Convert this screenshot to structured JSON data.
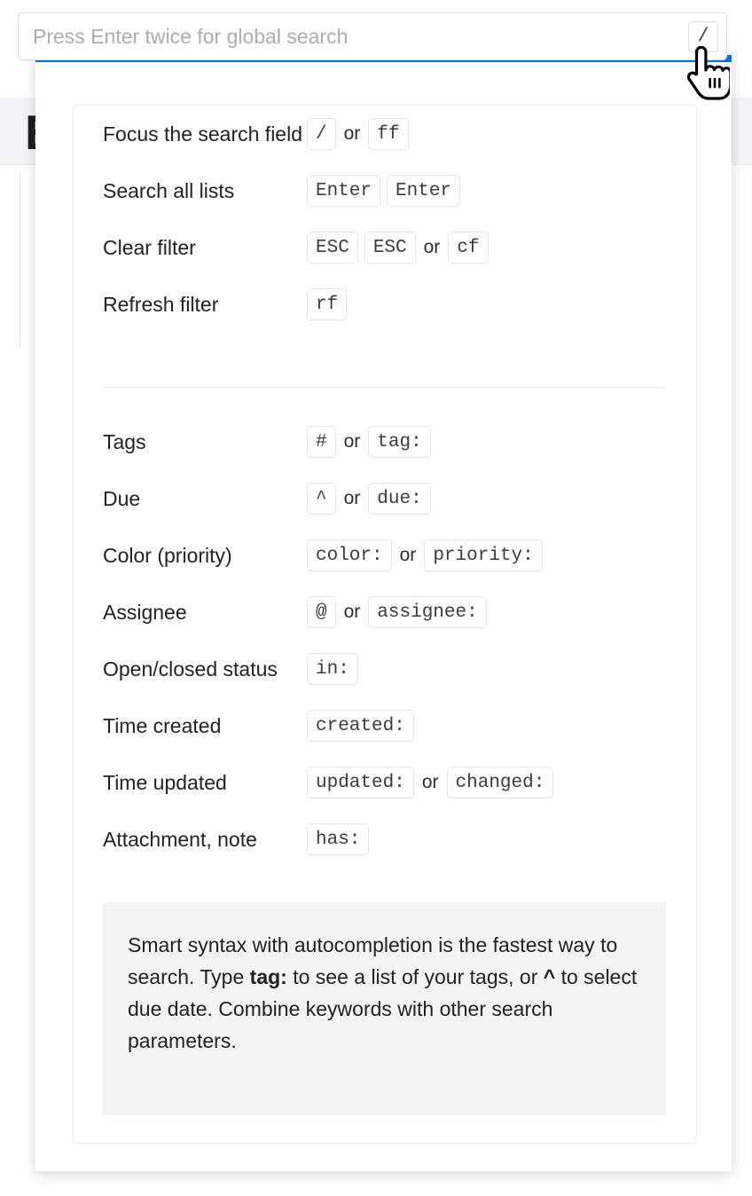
{
  "background": {
    "page_title": "E"
  },
  "search": {
    "placeholder": "Press Enter twice for global search",
    "value": "",
    "shortcut_chip": "/"
  },
  "panel": {
    "accent_color": "#0a6ede",
    "sections": [
      {
        "name": "commands",
        "rows": [
          {
            "label": "Focus the search field",
            "keys": [
              {
                "type": "chip",
                "text": "/"
              },
              {
                "type": "sep",
                "text": "or"
              },
              {
                "type": "chip",
                "text": "ff"
              }
            ]
          },
          {
            "label": "Search all lists",
            "keys": [
              {
                "type": "chip",
                "text": "Enter"
              },
              {
                "type": "gap",
                "text": ""
              },
              {
                "type": "chip",
                "text": "Enter"
              }
            ]
          },
          {
            "label": "Clear filter",
            "keys": [
              {
                "type": "chip",
                "text": "ESC"
              },
              {
                "type": "gap",
                "text": ""
              },
              {
                "type": "chip",
                "text": "ESC"
              },
              {
                "type": "sep",
                "text": "or"
              },
              {
                "type": "chip",
                "text": "cf"
              }
            ]
          },
          {
            "label": "Refresh filter",
            "keys": [
              {
                "type": "chip",
                "text": "rf"
              }
            ]
          }
        ]
      },
      {
        "name": "filters",
        "rows": [
          {
            "label": "Tags",
            "keys": [
              {
                "type": "chip",
                "text": "#"
              },
              {
                "type": "sep",
                "text": "or"
              },
              {
                "type": "chip",
                "text": "tag:"
              }
            ]
          },
          {
            "label": "Due",
            "keys": [
              {
                "type": "chip",
                "text": "^"
              },
              {
                "type": "sep",
                "text": "or"
              },
              {
                "type": "chip",
                "text": "due:"
              }
            ]
          },
          {
            "label": "Color (priority)",
            "keys": [
              {
                "type": "chip",
                "text": "color:"
              },
              {
                "type": "sep",
                "text": "or"
              },
              {
                "type": "chip",
                "text": "priority:"
              }
            ]
          },
          {
            "label": "Assignee",
            "keys": [
              {
                "type": "chip",
                "text": "@"
              },
              {
                "type": "sep",
                "text": "or"
              },
              {
                "type": "chip",
                "text": "assignee:"
              }
            ]
          },
          {
            "label": "Open/closed status",
            "keys": [
              {
                "type": "chip",
                "text": "in:"
              }
            ]
          },
          {
            "label": "Time created",
            "keys": [
              {
                "type": "chip",
                "text": "created:"
              }
            ]
          },
          {
            "label": "Time updated",
            "keys": [
              {
                "type": "chip",
                "text": "updated:"
              },
              {
                "type": "sep",
                "text": "or"
              },
              {
                "type": "chip",
                "text": "changed:"
              }
            ]
          },
          {
            "label": "Attachment, note",
            "keys": [
              {
                "type": "chip",
                "text": "has:"
              }
            ]
          }
        ]
      }
    ],
    "note": {
      "part1": "Smart syntax with autocompletion is the fastest way to search. Type ",
      "bold": "tag:",
      "part2": " to see a list of your tags, or ",
      "caret": "^",
      "part3": " to select due date. Combine keywords with other search parameters."
    }
  },
  "cursor": {
    "type": "pointing-hand"
  }
}
